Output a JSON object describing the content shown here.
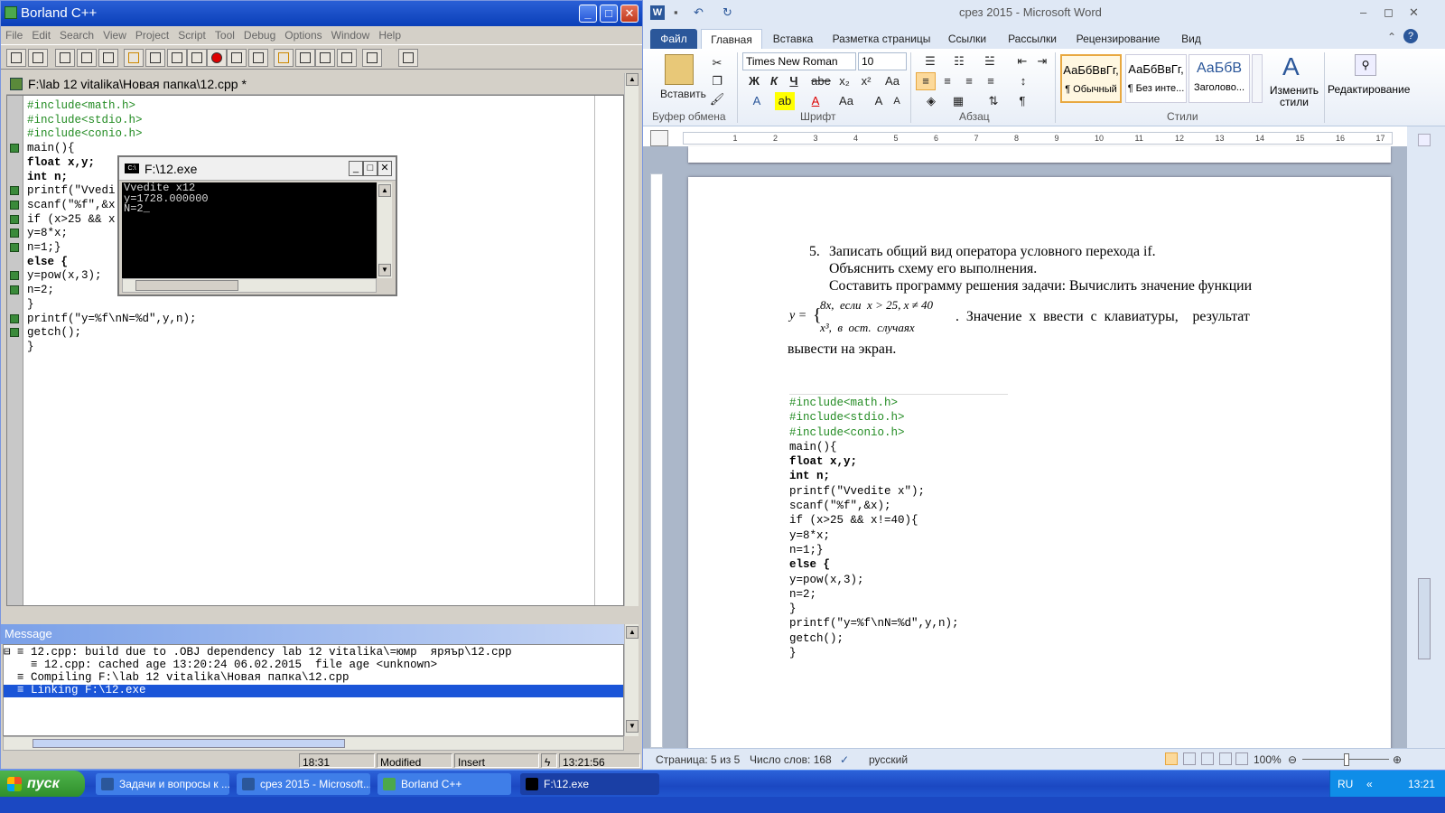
{
  "borland": {
    "title": "Borland C++",
    "menu": [
      "File",
      "Edit",
      "Search",
      "View",
      "Project",
      "Script",
      "Tool",
      "Debug",
      "Options",
      "Window",
      "Help"
    ],
    "editor_title": "F:\\lab 12 vitalika\\Новая папка\\12.cpp *",
    "code_lines": [
      "#include<math.h>",
      "#include<stdio.h>",
      "#include<conio.h>",
      "main(){",
      "float x,y;",
      "int n;",
      "printf(\"Vvedi",
      "scanf(\"%f\",&x",
      "if (x>25 && x",
      "y=8*x;",
      "n=1;}",
      "else {",
      "y=pow(x,3);",
      "n=2;",
      "}",
      "printf(\"y=%f\\nN=%d\",y,n);",
      "getch();",
      "}"
    ],
    "message_title": "Message",
    "messages": [
      "⊟ ≡ 12.cpp: build due to .OBJ dependency lab 12 vitalika\\=юмр  яряър\\12.cpp",
      "    ≡ 12.cpp: cached age 13:20:24 06.02.2015  file age <unknown>",
      "  ≡ Compiling F:\\lab 12 vitalika\\Новая папка\\12.cpp",
      "  ≡ Linking F:\\12.exe"
    ],
    "status": {
      "position": "18:31",
      "modified": "Modified",
      "mode": "Insert",
      "time": "13:21:56"
    }
  },
  "console": {
    "title": "F:\\12.exe",
    "output": "Vvedite x12\ny=1728.000000\nN=2_"
  },
  "word": {
    "title": "срез 2015  -  Microsoft Word",
    "tabs": [
      "Файл",
      "Главная",
      "Вставка",
      "Разметка страницы",
      "Ссылки",
      "Рассылки",
      "Рецензирование",
      "Вид"
    ],
    "active_tab": "Главная",
    "ribbon": {
      "paste": "Вставить",
      "font_name": "Times New Roman",
      "font_size": "10",
      "styles": [
        {
          "preview": "АаБбВвГг,",
          "name": "¶ Обычный"
        },
        {
          "preview": "АаБбВвГг,",
          "name": "¶ Без инте..."
        },
        {
          "preview": "АаБбВ",
          "name": "Заголово..."
        }
      ],
      "change_styles": "Изменить стили",
      "editing": "Редактирование",
      "groups": [
        "Буфер обмена",
        "Шрифт",
        "Абзац",
        "Стили"
      ]
    },
    "doc": {
      "item_num": "5.",
      "line1": "Записать общий вид оператора условного перехода if.",
      "line2": "Объяснить схему его выполнения.",
      "line3": "Составить программу решения задачи: Вычислить значение функции",
      "formula_y": "y =",
      "formula_case1": "8x,  если  x > 25, x ≠ 40",
      "formula_case2": "x³,  в  ост.  случаях",
      "line4": ".  Значение  x  ввести  с  клавиатуры,    результат",
      "line5": "вывести на экран.",
      "code_lines": [
        "#include<math.h>",
        "#include<stdio.h>",
        "#include<conio.h>",
        "main(){",
        "float x,y;",
        "int n;",
        "printf(\"Vvedite x\");",
        "scanf(\"%f\",&x);",
        "if (x>25 && x!=40){",
        "y=8*x;",
        "n=1;}",
        "else {",
        "y=pow(x,3);",
        "n=2;",
        "}",
        "printf(\"y=%f\\nN=%d\",y,n);",
        "getch();",
        "}"
      ]
    },
    "status": {
      "page": "Страница: 5 из 5",
      "words": "Число слов: 168",
      "lang": "русский",
      "zoom": "100%"
    }
  },
  "taskbar": {
    "start": "пуск",
    "items": [
      "Задачи и вопросы к ...",
      "срез 2015 - Microsoft...",
      "Borland C++",
      "F:\\12.exe"
    ],
    "lang": "RU",
    "clock": "13:21"
  }
}
